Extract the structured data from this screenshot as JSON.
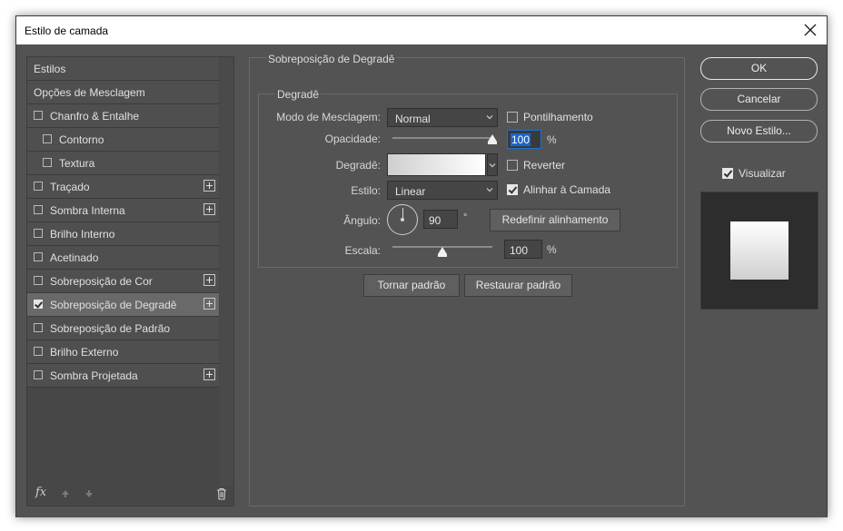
{
  "window": {
    "title": "Estilo de camada"
  },
  "left": {
    "items": [
      {
        "label": "Estilos",
        "checkbox": false,
        "plus": false,
        "indent": false,
        "selected": false
      },
      {
        "label": "Opções de Mesclagem",
        "checkbox": false,
        "plus": false,
        "indent": false,
        "selected": false
      },
      {
        "label": "Chanfro & Entalhe",
        "checkbox": true,
        "checked": false,
        "plus": false,
        "indent": false,
        "selected": false
      },
      {
        "label": "Contorno",
        "checkbox": true,
        "checked": false,
        "plus": false,
        "indent": true,
        "selected": false
      },
      {
        "label": "Textura",
        "checkbox": true,
        "checked": false,
        "plus": false,
        "indent": true,
        "selected": false
      },
      {
        "label": "Traçado",
        "checkbox": true,
        "checked": false,
        "plus": true,
        "indent": false,
        "selected": false
      },
      {
        "label": "Sombra Interna",
        "checkbox": true,
        "checked": false,
        "plus": true,
        "indent": false,
        "selected": false
      },
      {
        "label": "Brilho Interno",
        "checkbox": true,
        "checked": false,
        "plus": false,
        "indent": false,
        "selected": false
      },
      {
        "label": "Acetinado",
        "checkbox": true,
        "checked": false,
        "plus": false,
        "indent": false,
        "selected": false
      },
      {
        "label": "Sobreposição de Cor",
        "checkbox": true,
        "checked": false,
        "plus": true,
        "indent": false,
        "selected": false
      },
      {
        "label": "Sobreposição de Degradê",
        "checkbox": true,
        "checked": true,
        "plus": true,
        "indent": false,
        "selected": true
      },
      {
        "label": "Sobreposição de Padrão",
        "checkbox": true,
        "checked": false,
        "plus": false,
        "indent": false,
        "selected": false
      },
      {
        "label": "Brilho Externo",
        "checkbox": true,
        "checked": false,
        "plus": false,
        "indent": false,
        "selected": false
      },
      {
        "label": "Sombra Projetada",
        "checkbox": true,
        "checked": false,
        "plus": true,
        "indent": false,
        "selected": false
      }
    ],
    "tools": {
      "fx_label": "fx"
    }
  },
  "main": {
    "section_title": "Sobreposição de Degradê",
    "group_title": "Degradê",
    "blend_mode": {
      "label": "Modo de Mesclagem:",
      "value": "Normal"
    },
    "dither": {
      "label": "Pontilhamento",
      "checked": false
    },
    "opacity": {
      "label": "Opacidade:",
      "value": "100",
      "unit": "%",
      "level": 1.0
    },
    "gradient": {
      "label": "Degradê:"
    },
    "reverse": {
      "label": "Reverter",
      "checked": false
    },
    "style": {
      "label": "Estilo:",
      "value": "Linear"
    },
    "align": {
      "label": "Alinhar à Camada",
      "checked": true
    },
    "angle": {
      "label": "Ângulo:",
      "value": "90",
      "unit": "°"
    },
    "reset_align": "Redefinir alinhamento",
    "scale": {
      "label": "Escala:",
      "value": "100",
      "unit": "%",
      "level": 0.5
    },
    "make_default": "Tornar padrão",
    "reset_default": "Restaurar padrão"
  },
  "right": {
    "ok": "OK",
    "cancel": "Cancelar",
    "new_style": "Novo Estilo...",
    "preview": {
      "label": "Visualizar",
      "checked": true
    }
  }
}
